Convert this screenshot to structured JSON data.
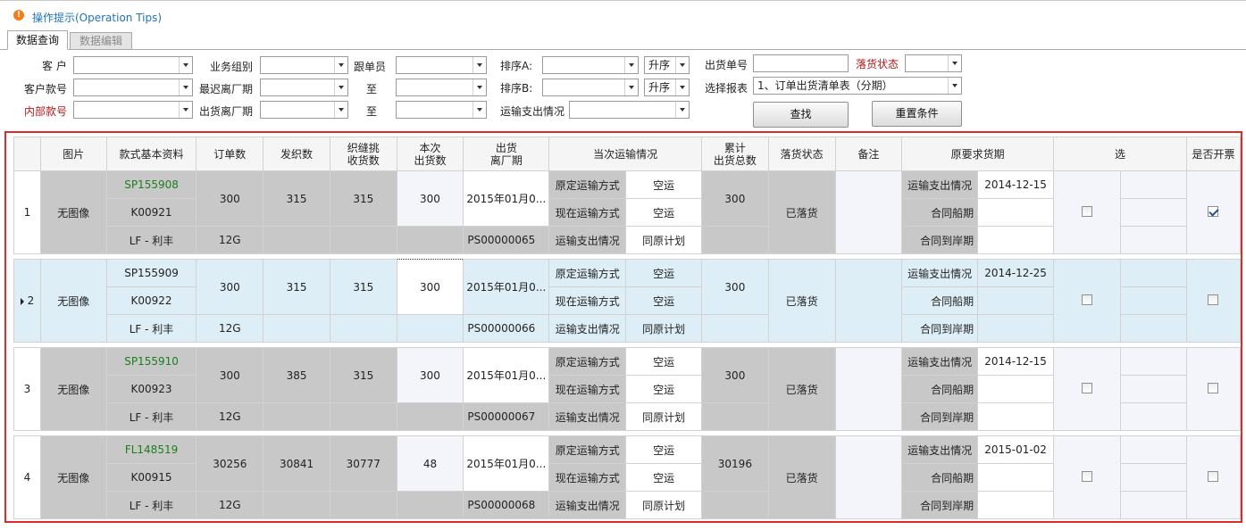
{
  "tips": {
    "icon": "warning-icon",
    "text": "操作提示(Operation Tips)"
  },
  "tabs": [
    {
      "label": "数据查询",
      "active": true
    },
    {
      "label": "数据编辑",
      "active": false
    }
  ],
  "filters": {
    "customer": "客 户",
    "biz_group": "业务组别",
    "follower": "跟单员",
    "sort_a": "排序A:",
    "sort_a_order": "升序",
    "ship_no": "出货单号",
    "land_status": "落货状态",
    "cust_style": "客户款号",
    "last_leave": "最迟离厂期",
    "to1": "至",
    "sort_b": "排序B:",
    "sort_b_order": "升序",
    "choose_report": "选择报表",
    "report_value": "1、订单出货清单表（分期）",
    "inner_style": "内部款号",
    "ship_leave": "出货离厂期",
    "to2": "至",
    "transport_cost": "运输支出情况",
    "search_btn": "查找",
    "reset_btn": "重置条件"
  },
  "grid": {
    "headers": {
      "picture": "图片",
      "style_info": "款式基本资料",
      "order_qty": "订单数",
      "knit_qty": "发织数",
      "stitch_qty_1": "织缝挑",
      "stitch_qty_2": "收货数",
      "this_ship_1": "本次",
      "this_ship_2": "出货数",
      "ship_leave_1": "出货",
      "ship_leave_2": "离厂期",
      "transport": "当次运输情况",
      "total_ship_1": "累计",
      "total_ship_2": "出货总数",
      "land_status": "落货状态",
      "remark": "备注",
      "orig_date": "原要求货期",
      "select": "选",
      "invoice": "是否开票"
    },
    "labels": {
      "orig_mode": "原定运输方式",
      "cur_mode": "现在运输方式",
      "cost": "运输支出情况",
      "contract_ship": "合同船期",
      "contract_port": "合同到岸期"
    },
    "rows": [
      {
        "no": "1",
        "picture": "无图像",
        "style_no": "SP155908",
        "style_green": true,
        "cust_no": "K00921",
        "factory": "LF - 利丰",
        "gauge": "12G",
        "order_qty": "300",
        "knit_qty": "315",
        "stitch_qty": "315",
        "this_ship": "300",
        "leave_date": "2015年01月0...",
        "ps_no": "PS00000065",
        "orig_mode": "空运",
        "cur_mode": "空运",
        "cost": "同原计划",
        "total_ship": "300",
        "land_status": "已落货",
        "orig_date": "2014-12-15",
        "invoice_checked": true,
        "selected": false
      },
      {
        "no": "2",
        "picture": "无图像",
        "style_no": "SP155909",
        "style_green": false,
        "cust_no": "K00922",
        "factory": "LF - 利丰",
        "gauge": "12G",
        "order_qty": "300",
        "knit_qty": "315",
        "stitch_qty": "315",
        "this_ship": "300",
        "leave_date": "2015年01月0...",
        "ps_no": "PS00000066",
        "orig_mode": "空运",
        "cur_mode": "空运",
        "cost": "同原计划",
        "total_ship": "300",
        "land_status": "已落货",
        "orig_date": "2014-12-25",
        "invoice_checked": false,
        "selected": true
      },
      {
        "no": "3",
        "picture": "无图像",
        "style_no": "SP155910",
        "style_green": true,
        "cust_no": "K00923",
        "factory": "LF - 利丰",
        "gauge": "12G",
        "order_qty": "300",
        "knit_qty": "385",
        "stitch_qty": "315",
        "this_ship": "300",
        "leave_date": "2015年01月0...",
        "ps_no": "PS00000067",
        "orig_mode": "空运",
        "cur_mode": "空运",
        "cost": "同原计划",
        "total_ship": "300",
        "land_status": "已落货",
        "orig_date": "2014-12-15",
        "invoice_checked": false,
        "selected": false
      },
      {
        "no": "4",
        "picture": "无图像",
        "style_no": "FL148519",
        "style_green": true,
        "cust_no": "K00915",
        "factory": "LF - 利丰",
        "gauge": "12G",
        "order_qty": "30256",
        "knit_qty": "30841",
        "stitch_qty": "30777",
        "this_ship": "48",
        "leave_date": "2015年01月0...",
        "ps_no": "PS00000068",
        "orig_mode": "空运",
        "cur_mode": "空运",
        "cost": "同原计划",
        "total_ship": "30196",
        "land_status": "已落货",
        "orig_date": "2015-01-02",
        "invoice_checked": false,
        "selected": false
      }
    ]
  }
}
